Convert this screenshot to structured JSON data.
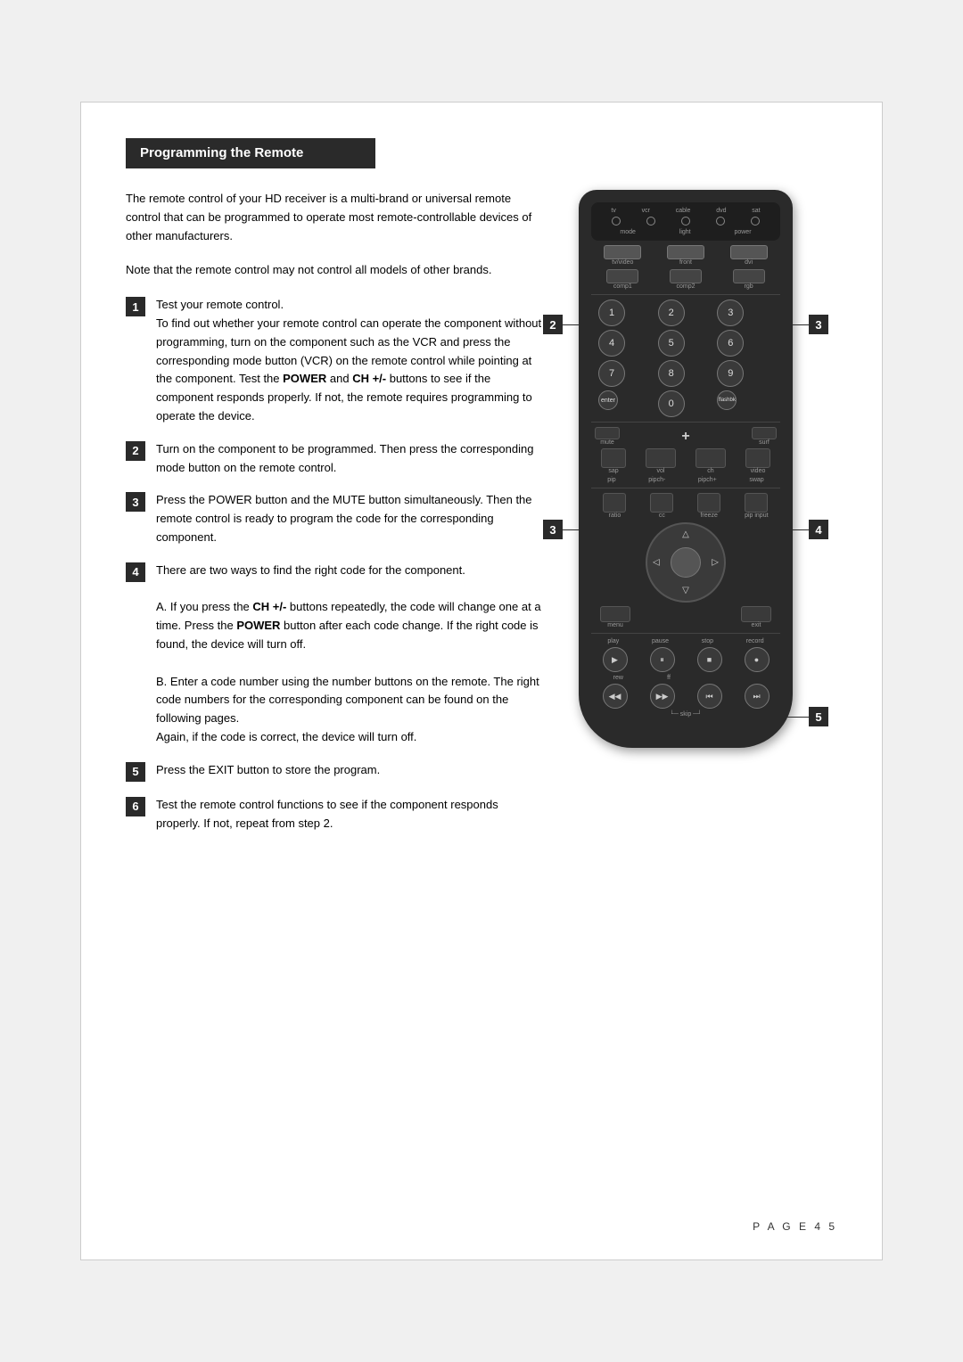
{
  "page": {
    "title": "Programming the Remote",
    "page_number": "P A G E   4 5"
  },
  "intro": {
    "para1": "The remote control of your HD receiver is a multi-brand or universal remote control that can be programmed to operate most remote-controllable devices of other manufacturers.",
    "para2": "Note that the remote control may not control all models of other brands."
  },
  "steps": [
    {
      "num": "1",
      "text": "Test your remote control.\nTo find out whether your remote control can operate the component without programming, turn on the component such as the VCR and press the corresponding mode button (VCR) on the remote control while pointing at the component. Test the POWER and CH +/- buttons to see if the component responds properly. If not, the remote requires programming to operate the device.",
      "bold_parts": [
        "POWER",
        "CH +/-"
      ]
    },
    {
      "num": "2",
      "text": "Turn on the component to be programmed. Then press the corresponding mode button on the remote control."
    },
    {
      "num": "3",
      "text": "Press the POWER button and the MUTE button simultaneously. Then the remote control is ready to program the code for the corresponding component."
    },
    {
      "num": "4",
      "text": "There are two ways to find the right code for the component.\n\nA. If you press the CH +/- buttons repeatedly, the code will change one at a time. Press the POWER button after each code change. If the right code is found, the device will turn off.\n\nB. Enter a code number using the number buttons on the remote. The right code numbers for the corresponding component can be found on the following pages.\nAgain, if the code is correct, the device will turn off.",
      "bold_parts": [
        "CH +/-",
        "POWER"
      ]
    },
    {
      "num": "5",
      "text": "Press the EXIT button to store the program."
    },
    {
      "num": "6",
      "text": "Test the remote control functions to see if the component responds properly. If not, repeat from step 2."
    }
  ],
  "callouts": [
    {
      "num": "2",
      "side": "left"
    },
    {
      "num": "3",
      "side": "left"
    },
    {
      "num": "4",
      "side": "right"
    },
    {
      "num": "5",
      "side": "right"
    }
  ],
  "remote": {
    "mode_indicators": [
      "tv",
      "vcr",
      "cable",
      "dvd",
      "sat"
    ],
    "indicator_labels": [
      "mode",
      "light",
      "power"
    ],
    "rows": {
      "row1_labels": [
        "tv/video",
        "front",
        "dvi"
      ],
      "row2_labels": [
        "comp1",
        "comp2",
        "rgb"
      ],
      "numbers": [
        "1",
        "2",
        "3",
        "4",
        "5",
        "6",
        "7",
        "8",
        "9",
        "enter",
        "0",
        "flashbk"
      ],
      "vol_labels": [
        "mute",
        "sap",
        "surf",
        "video"
      ],
      "transport_labels": [
        "play",
        "pause",
        "stop",
        "record"
      ],
      "transport2_labels": [
        "rew",
        "ff",
        "",
        ""
      ],
      "nav_labels": [
        "menu",
        "exit"
      ],
      "pip_labels": [
        "pip",
        "pipch-",
        "pipch+",
        "swap"
      ],
      "ratio_labels": [
        "ratio",
        "cc",
        "freeze",
        "pip input"
      ]
    }
  }
}
